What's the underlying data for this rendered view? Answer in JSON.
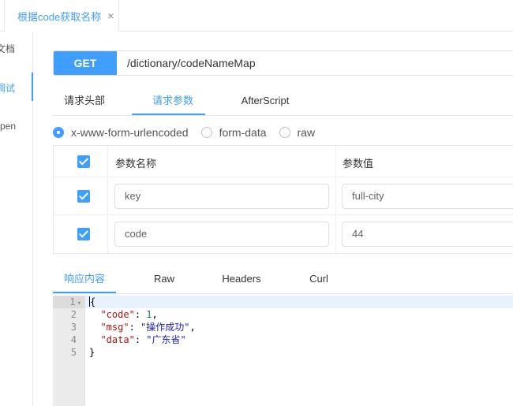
{
  "tabs": [
    {
      "label": "根据code获取名称",
      "close": "×",
      "active": true
    }
  ],
  "sidenav": {
    "items": [
      {
        "label": "文档"
      },
      {
        "label": "调试",
        "active": true
      },
      {
        "label": "pen"
      }
    ]
  },
  "request": {
    "method": "GET",
    "url": "/dictionary/codeNameMap"
  },
  "request_tabs": [
    {
      "label": "请求头部"
    },
    {
      "label": "请求参数",
      "active": true
    },
    {
      "label": "AfterScript"
    }
  ],
  "body_types": [
    {
      "label": "x-www-form-urlencoded",
      "checked": true
    },
    {
      "label": "form-data",
      "checked": false
    },
    {
      "label": "raw",
      "checked": false
    }
  ],
  "params_table": {
    "headers": [
      "参数名称",
      "参数值"
    ],
    "rows": [
      {
        "checked": true,
        "name": "key",
        "value": "full-city"
      },
      {
        "checked": true,
        "name": "code",
        "value": "44"
      }
    ]
  },
  "response_tabs": [
    {
      "label": "响应内容",
      "active": true
    },
    {
      "label": "Raw"
    },
    {
      "label": "Headers"
    },
    {
      "label": "Curl"
    }
  ],
  "response_code": {
    "line_numbers": [
      "1",
      "2",
      "3",
      "4",
      "5"
    ],
    "fold_marker": "▾",
    "lines": {
      "l1": "{",
      "l2_key": "\"code\"",
      "l2_sep": ": ",
      "l2_val": "1",
      "l2_end": ",",
      "l3_key": "\"msg\"",
      "l3_sep": ": ",
      "l3_val": "\"操作成功\"",
      "l3_end": ",",
      "l4_key": "\"data\"",
      "l4_sep": ": ",
      "l4_val": "\"广东省\"",
      "l5": "}"
    }
  },
  "colors": {
    "accent": "#409eff",
    "json_key": "#a31515",
    "json_string": "#2222aa",
    "json_number": "#098658"
  }
}
